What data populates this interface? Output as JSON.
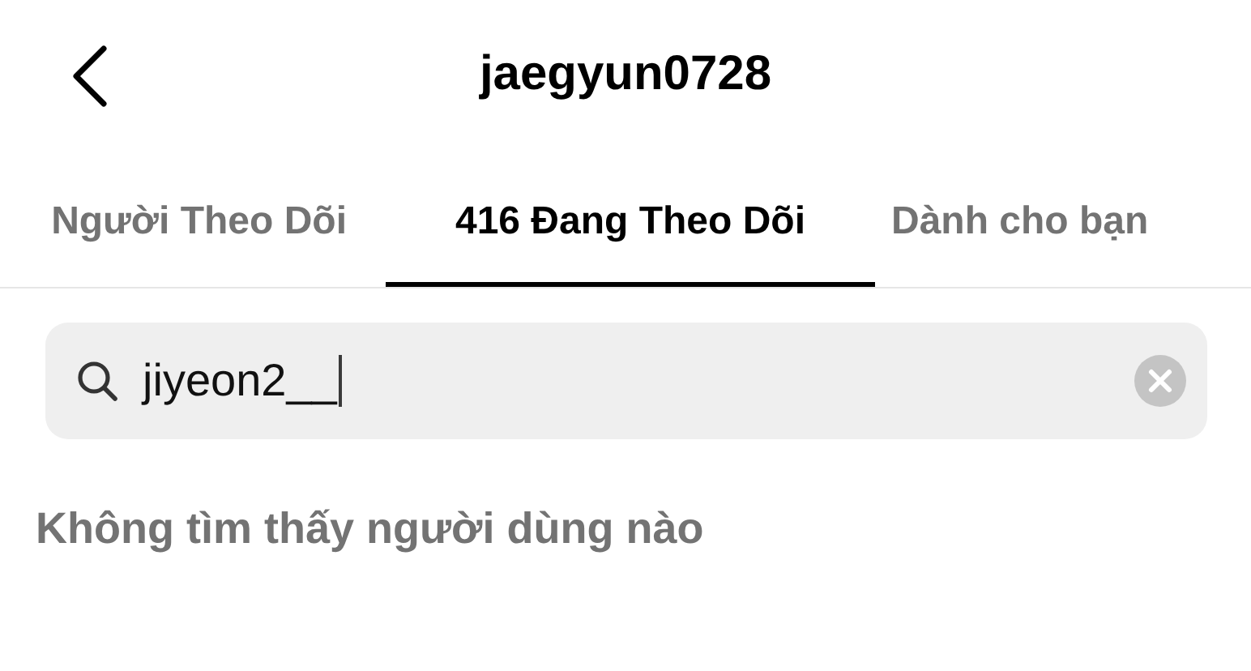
{
  "header": {
    "title": "jaegyun0728"
  },
  "tabs": [
    {
      "label": "Người Theo Dõi",
      "selected": false
    },
    {
      "label": "416 Đang Theo Dõi",
      "selected": true
    },
    {
      "label": "Dành cho bạn",
      "selected": false
    }
  ],
  "search": {
    "value": "jiyeon2__",
    "focused": true
  },
  "empty_message": "Không tìm thấy người dùng nào"
}
